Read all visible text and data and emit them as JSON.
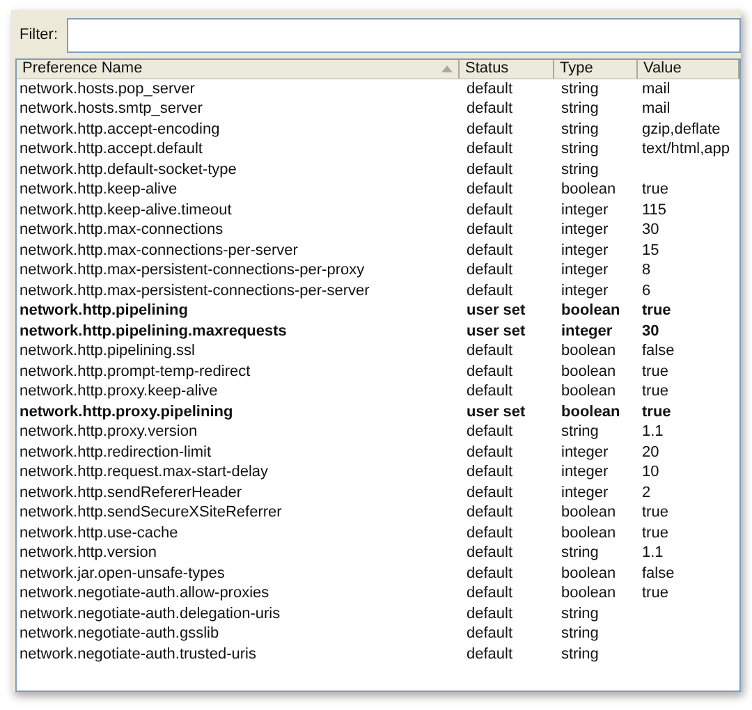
{
  "filter": {
    "label": "Filter:"
  },
  "table": {
    "columns": [
      {
        "label": "Preference Name",
        "sorted": true
      },
      {
        "label": "Status",
        "sorted": false
      },
      {
        "label": "Type",
        "sorted": false
      },
      {
        "label": "Value",
        "sorted": false
      }
    ],
    "rows": [
      {
        "name": "network.hosts.pop_server",
        "status": "default",
        "type": "string",
        "value": "mail",
        "modified": false
      },
      {
        "name": "network.hosts.smtp_server",
        "status": "default",
        "type": "string",
        "value": "mail",
        "modified": false
      },
      {
        "name": "network.http.accept-encoding",
        "status": "default",
        "type": "string",
        "value": "gzip,deflate",
        "modified": false
      },
      {
        "name": "network.http.accept.default",
        "status": "default",
        "type": "string",
        "value": "text/html,app",
        "modified": false
      },
      {
        "name": "network.http.default-socket-type",
        "status": "default",
        "type": "string",
        "modified": false
      },
      {
        "name": "network.http.keep-alive",
        "status": "default",
        "type": "boolean",
        "value": "true",
        "modified": false
      },
      {
        "name": "network.http.keep-alive.timeout",
        "status": "default",
        "type": "integer",
        "value": "115",
        "modified": false
      },
      {
        "name": "network.http.max-connections",
        "status": "default",
        "type": "integer",
        "value": "30",
        "modified": false
      },
      {
        "name": "network.http.max-connections-per-server",
        "status": "default",
        "type": "integer",
        "value": "15",
        "modified": false
      },
      {
        "name": "network.http.max-persistent-connections-per-proxy",
        "status": "default",
        "type": "integer",
        "value": "8",
        "modified": false
      },
      {
        "name": "network.http.max-persistent-connections-per-server",
        "status": "default",
        "type": "integer",
        "value": "6",
        "modified": false
      },
      {
        "name": "network.http.pipelining",
        "status": "user set",
        "type": "boolean",
        "value": "true",
        "modified": true
      },
      {
        "name": "network.http.pipelining.maxrequests",
        "status": "user set",
        "type": "integer",
        "value": "30",
        "modified": true
      },
      {
        "name": "network.http.pipelining.ssl",
        "status": "default",
        "type": "boolean",
        "value": "false",
        "modified": false
      },
      {
        "name": "network.http.prompt-temp-redirect",
        "status": "default",
        "type": "boolean",
        "value": "true",
        "modified": false
      },
      {
        "name": "network.http.proxy.keep-alive",
        "status": "default",
        "type": "boolean",
        "value": "true",
        "modified": false
      },
      {
        "name": "network.http.proxy.pipelining",
        "status": "user set",
        "type": "boolean",
        "value": "true",
        "modified": true
      },
      {
        "name": "network.http.proxy.version",
        "status": "default",
        "type": "string",
        "value": "1.1",
        "modified": false
      },
      {
        "name": "network.http.redirection-limit",
        "status": "default",
        "type": "integer",
        "value": "20",
        "modified": false
      },
      {
        "name": "network.http.request.max-start-delay",
        "status": "default",
        "type": "integer",
        "value": "10",
        "modified": false
      },
      {
        "name": "network.http.sendRefererHeader",
        "status": "default",
        "type": "integer",
        "value": "2",
        "modified": false
      },
      {
        "name": "network.http.sendSecureXSiteReferrer",
        "status": "default",
        "type": "boolean",
        "value": "true",
        "modified": false
      },
      {
        "name": "network.http.use-cache",
        "status": "default",
        "type": "boolean",
        "value": "true",
        "modified": false
      },
      {
        "name": "network.http.version",
        "status": "default",
        "type": "string",
        "value": "1.1",
        "modified": false
      },
      {
        "name": "network.jar.open-unsafe-types",
        "status": "default",
        "type": "boolean",
        "value": "false",
        "modified": false
      },
      {
        "name": "network.negotiate-auth.allow-proxies",
        "status": "default",
        "type": "boolean",
        "value": "true",
        "modified": false
      },
      {
        "name": "network.negotiate-auth.delegation-uris",
        "status": "default",
        "type": "string",
        "modified": false
      },
      {
        "name": "network.negotiate-auth.gsslib",
        "status": "default",
        "type": "string",
        "modified": false
      },
      {
        "name": "network.negotiate-auth.trusted-uris",
        "status": "default",
        "type": "string",
        "modified": false
      }
    ]
  }
}
